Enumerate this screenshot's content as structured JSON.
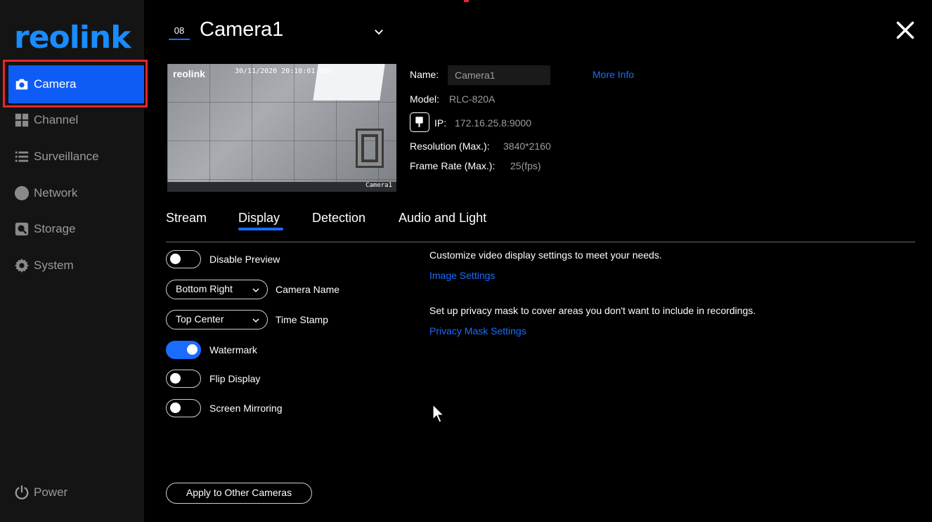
{
  "sidebar": {
    "logo": "reolink",
    "items": [
      {
        "label": "Camera",
        "icon": "camera-icon",
        "active": true
      },
      {
        "label": "Channel",
        "icon": "grid-icon",
        "active": false
      },
      {
        "label": "Surveillance",
        "icon": "list-icon",
        "active": false
      },
      {
        "label": "Network",
        "icon": "globe-icon",
        "active": false
      },
      {
        "label": "Storage",
        "icon": "storage-icon",
        "active": false
      },
      {
        "label": "System",
        "icon": "gear-icon",
        "active": false
      }
    ],
    "power_label": "Power"
  },
  "header": {
    "channel_number": "08",
    "camera_title": "Camera1"
  },
  "preview": {
    "watermark": "reolink",
    "timestamp": "30/11/2020 20:10:01 MON",
    "camera_name_overlay": "Camera1"
  },
  "info": {
    "name_label": "Name:",
    "name_value": "Camera1",
    "more_info": "More Info",
    "model_label": "Model:",
    "model_value": "RLC-820A",
    "ip_label": "IP:",
    "ip_value": "172.16.25.8:9000",
    "resolution_label": "Resolution (Max.):",
    "resolution_value": "3840*2160",
    "framerate_label": "Frame Rate (Max.):",
    "framerate_value": "25(fps)"
  },
  "tabs": [
    "Stream",
    "Display",
    "Detection",
    "Audio and Light"
  ],
  "active_tab": "Display",
  "options": {
    "disable_preview": {
      "label": "Disable Preview",
      "on": false
    },
    "camera_name": {
      "label": "Camera Name",
      "value": "Bottom Right"
    },
    "time_stamp": {
      "label": "Time Stamp",
      "value": "Top Center"
    },
    "watermark": {
      "label": "Watermark",
      "on": true
    },
    "flip_display": {
      "label": "Flip Display",
      "on": false
    },
    "screen_mirroring": {
      "label": "Screen Mirroring",
      "on": false
    }
  },
  "right_panel": {
    "desc1": "Customize video display settings to meet your needs.",
    "link1": "Image Settings",
    "desc2": "Set up privacy mask to cover areas you don't want to include in recordings.",
    "link2": "Privacy Mask Settings"
  },
  "apply_button": "Apply to Other Cameras",
  "colors": {
    "accent": "#1a6cff",
    "highlight": "#e8262b",
    "sidebar_bg": "#141414"
  }
}
